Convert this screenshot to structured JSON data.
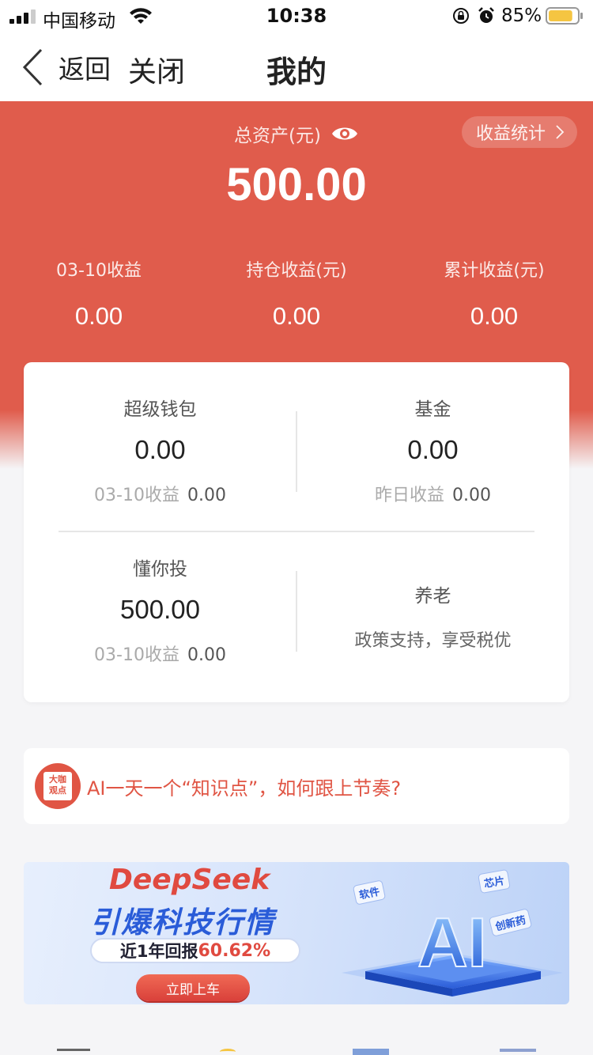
{
  "status_bar": {
    "carrier": "中国移动",
    "time": "10:38",
    "battery_percent": "85%",
    "battery_level": 0.85,
    "battery_color": "#f5c542"
  },
  "nav": {
    "back_label": "返回",
    "close_label": "关闭",
    "title": "我的"
  },
  "summary": {
    "total_label": "总资产(元)",
    "stats_button": "收益统计",
    "total_value": "500.00",
    "earnings": [
      {
        "label": "03-10收益",
        "value": "0.00"
      },
      {
        "label": "持仓收益(元)",
        "value": "0.00"
      },
      {
        "label": "累计收益(元)",
        "value": "0.00"
      }
    ],
    "accent_color": "#e05c4c"
  },
  "assets": {
    "super_wallet": {
      "title": "超级钱包",
      "value": "0.00",
      "sub_label": "03-10收益",
      "sub_value": "0.00"
    },
    "fund": {
      "title": "基金",
      "value": "0.00",
      "sub_label": "昨日收益",
      "sub_value": "0.00"
    },
    "dongnitou": {
      "title": "懂你投",
      "value": "500.00",
      "sub_label": "03-10收益",
      "sub_value": "0.00"
    },
    "pension": {
      "title": "养老",
      "desc": "政策支持，享受税优"
    }
  },
  "news": {
    "badge_line1": "大咖",
    "badge_line2": "观点",
    "text": "AI一天一个“知识点”，如何跟上节奏?"
  },
  "banner": {
    "title1": "DeepSeek",
    "title2": "引爆科技行情",
    "return_label": "近1年回报",
    "return_value": "60.62%",
    "cta": "立即上车",
    "art_text": "AI",
    "tag_software": "软件",
    "tag_chip": "芯片",
    "tag_drug": "创新药"
  }
}
